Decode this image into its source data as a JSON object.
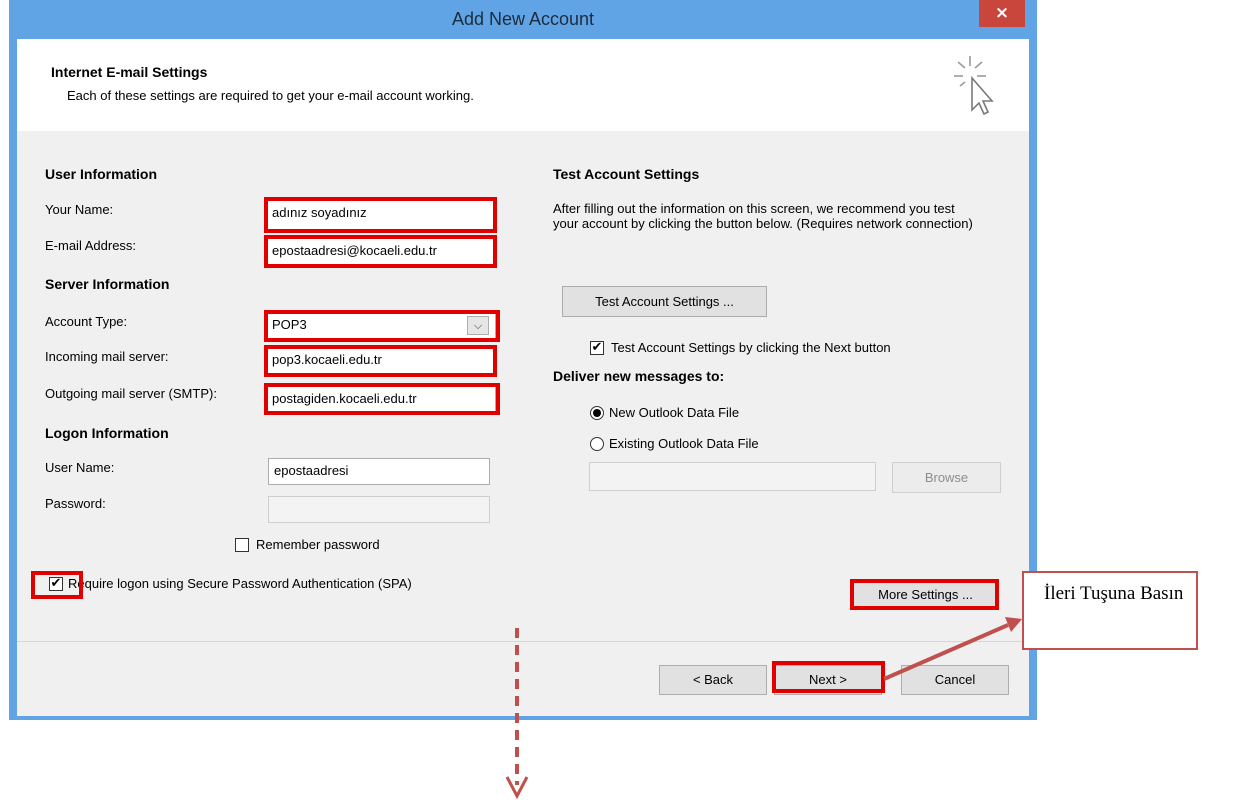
{
  "window": {
    "title": "Add New Account",
    "close_symbol": "×"
  },
  "header": {
    "title": "Internet E-mail Settings",
    "subtitle": "Each of these settings are required to get your e-mail account working.",
    "icon": "cursor-sparkle-icon"
  },
  "user_info": {
    "heading": "User Information",
    "name_label": "Your Name:",
    "name_value": "adınız soyadınız",
    "email_label": "E-mail Address:",
    "email_value": "epostaadresi@kocaeli.edu.tr"
  },
  "server_info": {
    "heading": "Server Information",
    "account_type_label": "Account Type:",
    "account_type_value": "POP3",
    "incoming_label": "Incoming mail server:",
    "incoming_value": "pop3.kocaeli.edu.tr",
    "outgoing_label": "Outgoing mail server (SMTP):",
    "outgoing_value": "postagiden.kocaeli.edu.tr"
  },
  "logon_info": {
    "heading": "Logon Information",
    "username_label": "User Name:",
    "username_value": "epostaadresi",
    "password_label": "Password:",
    "password_value": "",
    "remember_label": "Remember password",
    "remember_checked": false,
    "spa_label": "Require logon using Secure Password Authentication (SPA)",
    "spa_checked": true
  },
  "test_settings": {
    "heading": "Test Account Settings",
    "description": "After filling out the information on this screen, we recommend you test your account by clicking the button below. (Requires network connection)",
    "test_button": "Test Account Settings ...",
    "auto_test_label": "Test Account Settings by clicking the Next button",
    "auto_test_checked": true
  },
  "deliver": {
    "heading": "Deliver new messages to:",
    "option_new": "New Outlook Data File",
    "option_existing": "Existing Outlook Data File",
    "selected": "new",
    "file_path": "",
    "browse_button": "Browse"
  },
  "buttons": {
    "more_settings": "More Settings ...",
    "back": "< Back",
    "next": "Next >",
    "cancel": "Cancel"
  },
  "annotation": {
    "callout_text": "İleri Tuşuna Basın",
    "highlight_color": "#e00000",
    "arrow_color": "#c0504d"
  }
}
